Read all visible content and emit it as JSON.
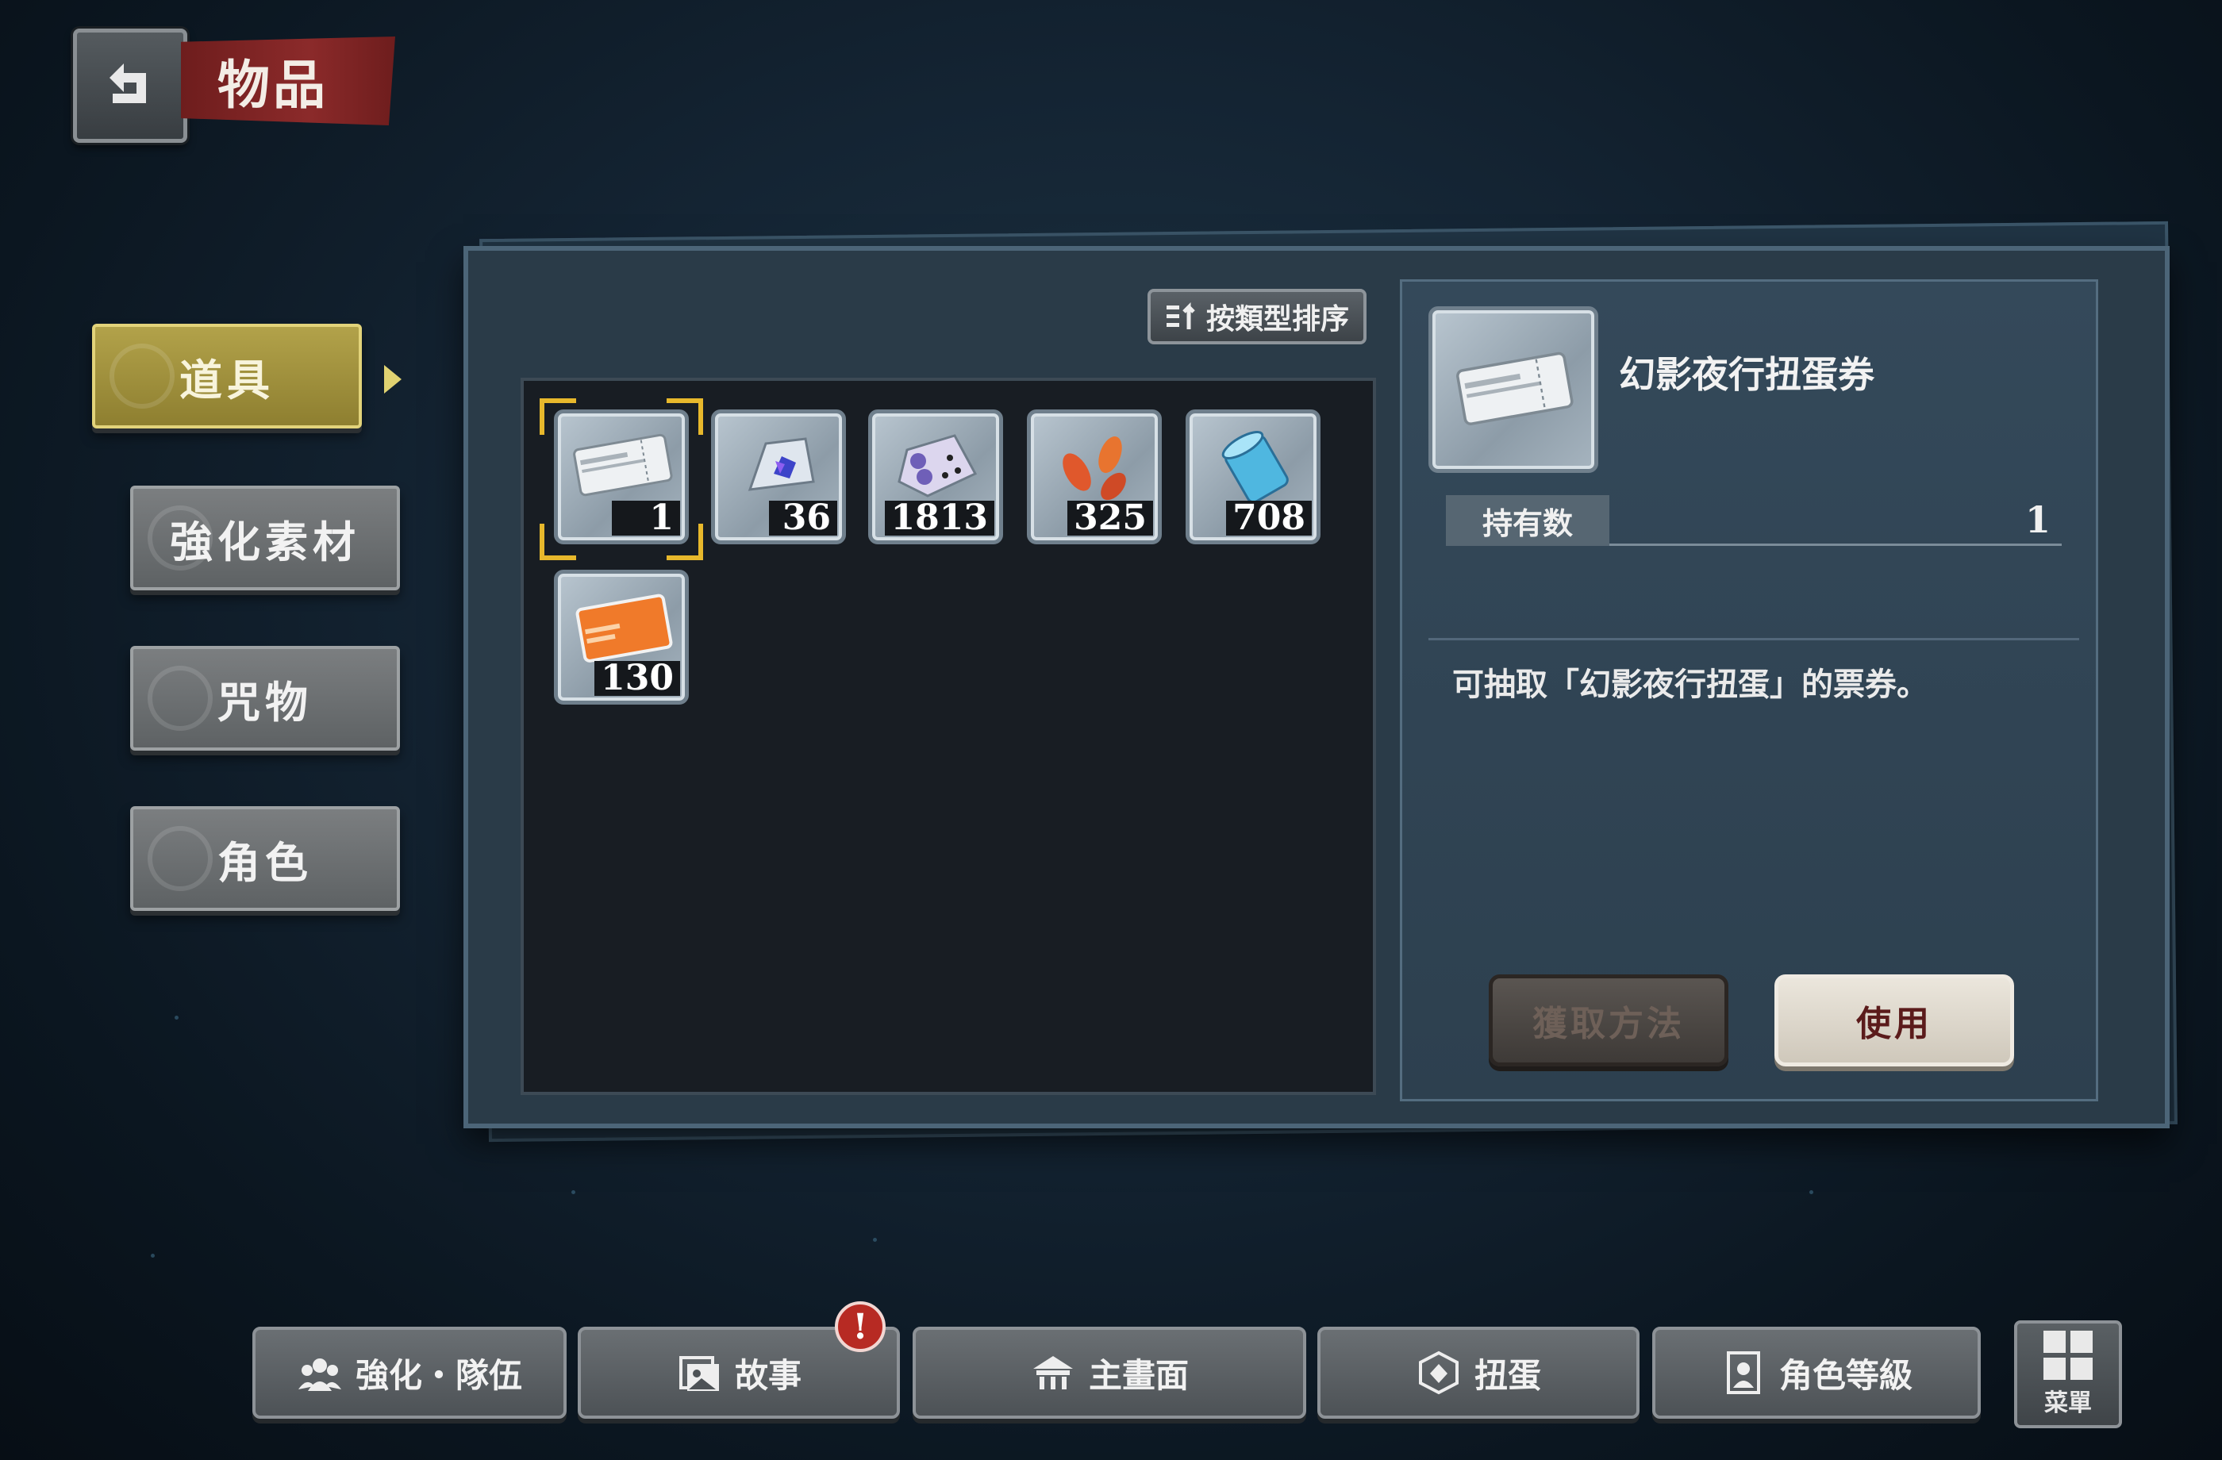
{
  "header": {
    "title": "物品"
  },
  "categories": [
    {
      "label": "道具",
      "active": true
    },
    {
      "label": "強化素材",
      "active": false
    },
    {
      "label": "咒物",
      "active": false
    },
    {
      "label": "角色",
      "active": false
    }
  ],
  "toolbar": {
    "sort_label": "按類型排序"
  },
  "items": [
    {
      "icon": "gacha-ticket-icon",
      "count": "1",
      "selected": true
    },
    {
      "icon": "blue-crystal-pouch-icon",
      "count": "36"
    },
    {
      "icon": "purple-dice-crystal-icon",
      "count": "1813"
    },
    {
      "icon": "orange-leaves-icon",
      "count": "325"
    },
    {
      "icon": "blue-cylinder-icon",
      "count": "708"
    },
    {
      "icon": "point-charge-card-icon",
      "count": "130"
    }
  ],
  "detail": {
    "name": "幻影夜行扭蛋券",
    "held_label": "持有数",
    "held_value": "1",
    "description": "可抽取「幻影夜行扭蛋」的票券。",
    "how_to_get_label": "獲取方法",
    "use_label": "使用"
  },
  "bottom_nav": {
    "items": [
      {
        "label": "強化・隊伍",
        "icon": "team-icon"
      },
      {
        "label": "故事",
        "icon": "story-icon",
        "alert": "!"
      },
      {
        "label": "主畫面",
        "icon": "home-icon"
      },
      {
        "label": "扭蛋",
        "icon": "gacha-icon"
      },
      {
        "label": "角色等級",
        "icon": "character-icon"
      }
    ],
    "menu_label": "菜單"
  },
  "colors": {
    "accent_gold": "#e7b82c",
    "title_red": "#8b2a2a",
    "use_text": "#5b1b1b"
  }
}
